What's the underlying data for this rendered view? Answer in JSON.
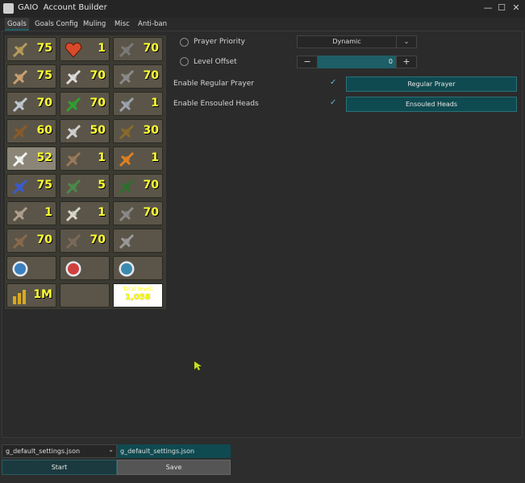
{
  "window": {
    "title": "GAIO  Account Builder",
    "minimize": "—",
    "maximize": "☐",
    "close": "✕"
  },
  "tabs": [
    {
      "label": "Goals",
      "active": true
    },
    {
      "label": "Goals Config"
    },
    {
      "label": "Muling"
    },
    {
      "label": "Misc"
    },
    {
      "label": "Anti-ban"
    }
  ],
  "skills": [
    {
      "icon": "attack-icon",
      "level": "75"
    },
    {
      "icon": "hitpoints-icon",
      "level": "1"
    },
    {
      "icon": "mining-icon",
      "level": "70"
    },
    {
      "icon": "strength-icon",
      "level": "75"
    },
    {
      "icon": "agility-icon",
      "level": "70"
    },
    {
      "icon": "smithing-icon",
      "level": "70"
    },
    {
      "icon": "defence-icon",
      "level": "70"
    },
    {
      "icon": "herblore-icon",
      "level": "70"
    },
    {
      "icon": "fishing-icon",
      "level": "1"
    },
    {
      "icon": "ranged-icon",
      "level": "60"
    },
    {
      "icon": "thieving-icon",
      "level": "50"
    },
    {
      "icon": "cooking-icon",
      "level": "30"
    },
    {
      "icon": "prayer-icon",
      "level": "52",
      "active": true
    },
    {
      "icon": "crafting-icon",
      "level": "1"
    },
    {
      "icon": "firemaking-icon",
      "level": "1"
    },
    {
      "icon": "magic-icon",
      "level": "75"
    },
    {
      "icon": "fletching-icon",
      "level": "5"
    },
    {
      "icon": "woodcutting-icon",
      "level": "70"
    },
    {
      "icon": "runecraft-icon",
      "level": "1"
    },
    {
      "icon": "slayer-icon",
      "level": "1"
    },
    {
      "icon": "farming-icon",
      "level": "70"
    },
    {
      "icon": "construction-icon",
      "level": "70"
    },
    {
      "icon": "hunter-icon",
      "level": "70"
    },
    {
      "icon": "sailing-icon",
      "level": ""
    },
    {
      "icon": "quest-icon",
      "level": ""
    },
    {
      "icon": "minigame-icon",
      "level": ""
    },
    {
      "icon": "task-icon",
      "level": ""
    },
    {
      "icon": "gold-icon",
      "level": "1M"
    },
    {
      "icon": "",
      "level": ""
    }
  ],
  "total": {
    "label": "Total level:",
    "value": "1,058"
  },
  "settings": {
    "prayer_priority_label": "Prayer Priority",
    "prayer_priority_value": "Dynamic",
    "level_offset_label": "Level Offset",
    "level_offset_value": "0",
    "enable_regular_label": "Enable Regular Prayer",
    "enable_ensouled_label": "Enable Ensouled Heads",
    "regular_button": "Regular Prayer",
    "ensouled_button": "Ensouled Heads"
  },
  "bottom": {
    "profile_select": "g_default_settings.json",
    "profile_name": "g_default_settings.json",
    "start": "Start",
    "save": "Save"
  }
}
